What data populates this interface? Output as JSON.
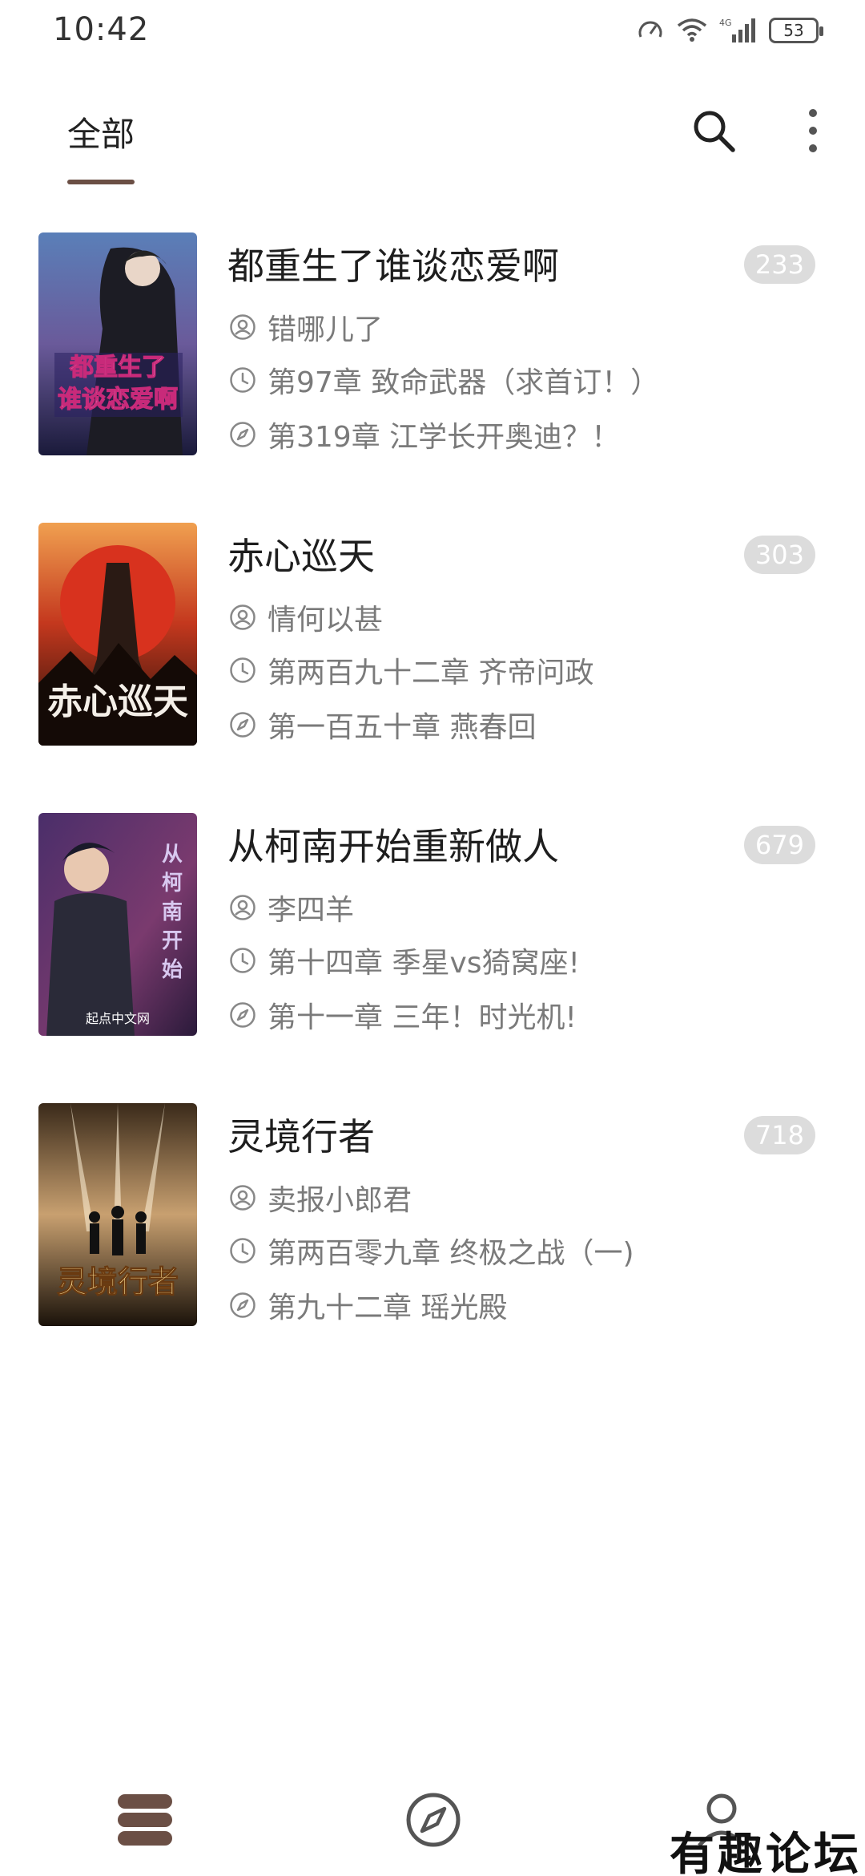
{
  "status_bar": {
    "time": "10:42",
    "network": "4G",
    "battery": "53"
  },
  "header": {
    "tab_label": "全部",
    "accent_color": "#6b4f45"
  },
  "books": [
    {
      "title": "都重生了谁谈恋爱啊",
      "badge": "233",
      "author": "错哪儿了",
      "latest_chapter": "第97章 致命武器（求首订！）",
      "read_chapter": "第319章 江学长开奥迪？！",
      "cover_text": [
        "都重生了",
        "谁谈恋爱啊"
      ]
    },
    {
      "title": "赤心巡天",
      "badge": "303",
      "author": "情何以甚",
      "latest_chapter": "第两百九十二章 齐帝问政",
      "read_chapter": "第一百五十章 燕春回",
      "cover_text": [
        "赤心巡天"
      ]
    },
    {
      "title": "从柯南开始重新做人",
      "badge": "679",
      "author": "李四羊",
      "latest_chapter": "第十四章 季星vs猗窝座!",
      "read_chapter": "第十一章 三年！时光机!",
      "cover_text": [
        "从柯南开始",
        "起点中文网"
      ]
    },
    {
      "title": "灵境行者",
      "badge": "718",
      "author": "卖报小郎君",
      "latest_chapter": "第两百零九章 终极之战（一)",
      "read_chapter": "第九十二章 瑶光殿",
      "cover_text": [
        "灵境行者"
      ]
    }
  ],
  "icons": {
    "author": "user-circle-icon",
    "latest": "clock-icon",
    "read": "compass-icon"
  },
  "bottom_nav": {
    "items": [
      "bookshelf-icon",
      "discover-compass-icon",
      "profile-icon"
    ],
    "active_color": "#6b4f45"
  },
  "watermark": "有趣论坛"
}
